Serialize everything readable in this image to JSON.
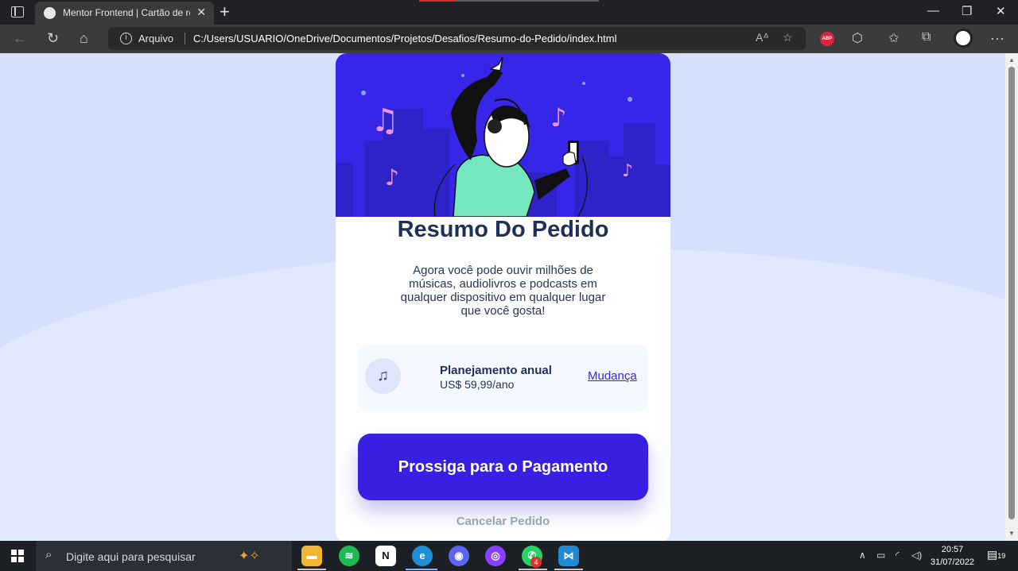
{
  "browser": {
    "tab_title": "Mentor Frontend | Cartão de resumo",
    "address_label": "Arquivo",
    "url": "C:/Users/USUARIO/OneDrive/Documentos/Projetos/Desafios/Resumo-do-Pedido/index.html",
    "abp_label": "ABP"
  },
  "card": {
    "title": "Resumo Do Pedido",
    "description": "Agora você pode ouvir milhões de músicas, audiolivros e podcasts em qualquer dispositivo em qualquer lugar que você gosta!",
    "plan": {
      "name": "Planejamento anual",
      "price": "US$ 59,99/ano",
      "change_label": "Mudança",
      "icon": "music-note-icon"
    },
    "pay_button": "Prossiga para o Pagamento",
    "cancel_label": "Cancelar Pedido"
  },
  "taskbar": {
    "search_placeholder": "Digite aqui para pesquisar",
    "apps": [
      "file-explorer",
      "spotify",
      "notion",
      "edge",
      "discord",
      "github-desktop",
      "whatsapp",
      "vscode"
    ],
    "whatsapp_badge": "4",
    "time": "20:57",
    "date": "31/07/2022",
    "notification_count": "19"
  },
  "colors": {
    "page_bg": "#d6e0fc",
    "hero_bg": "#3726e8",
    "accent": "#3a1fe2",
    "title": "#1f2f56",
    "muted": "#9aa2b3"
  }
}
